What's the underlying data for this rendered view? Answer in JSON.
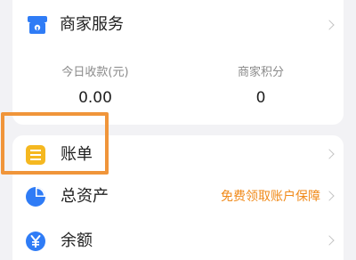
{
  "merchant": {
    "service_label": "商家服务",
    "stats": [
      {
        "label": "今日收款(元)",
        "value": "0.00"
      },
      {
        "label": "商家积分",
        "value": "0"
      }
    ]
  },
  "list": {
    "items": [
      {
        "label": "账单",
        "icon": "bill-icon"
      },
      {
        "label": "总资产",
        "icon": "pie-chart-icon",
        "promo": "免费领取账户保障"
      },
      {
        "label": "余额",
        "icon": "yuan-icon"
      }
    ]
  },
  "colors": {
    "accent_blue": "#2f7cf6",
    "bill_yellow": "#f5b820",
    "promo_orange": "#f08a1a",
    "highlight_orange": "#f0953a"
  }
}
